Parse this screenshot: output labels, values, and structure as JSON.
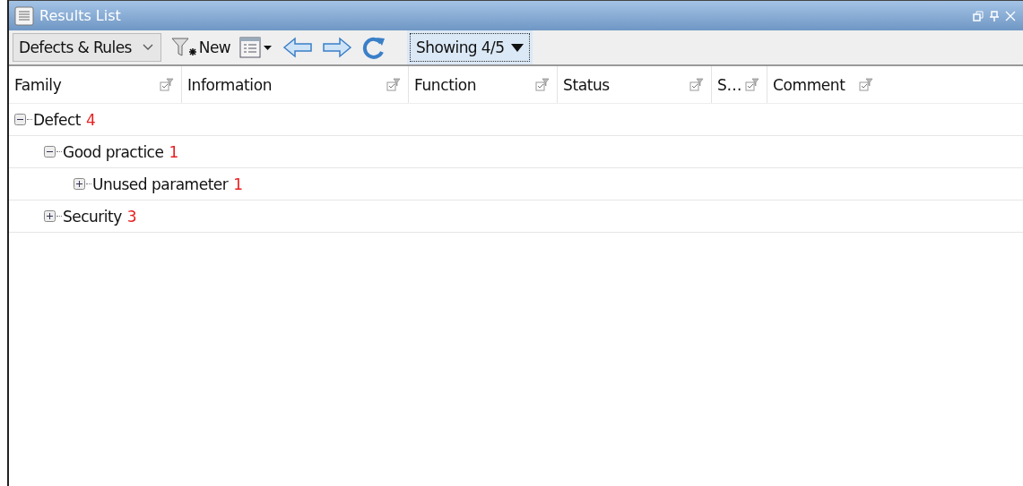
{
  "window": {
    "title": "Results List"
  },
  "toolbar": {
    "mode": "Defects & Rules",
    "new_label": "New",
    "showing": "Showing 4/5"
  },
  "table": {
    "columns": [
      "Family",
      "Information",
      "Function",
      "Status",
      "S…",
      "Comment"
    ],
    "rows": [
      {
        "label": "Defect",
        "count": "4",
        "expanded": true,
        "children": [
          {
            "label": "Good practice",
            "count": "1",
            "expanded": true,
            "children": [
              {
                "label": "Unused parameter",
                "count": "1",
                "expanded": false
              }
            ]
          },
          {
            "label": "Security",
            "count": "3",
            "expanded": false
          }
        ]
      }
    ]
  }
}
